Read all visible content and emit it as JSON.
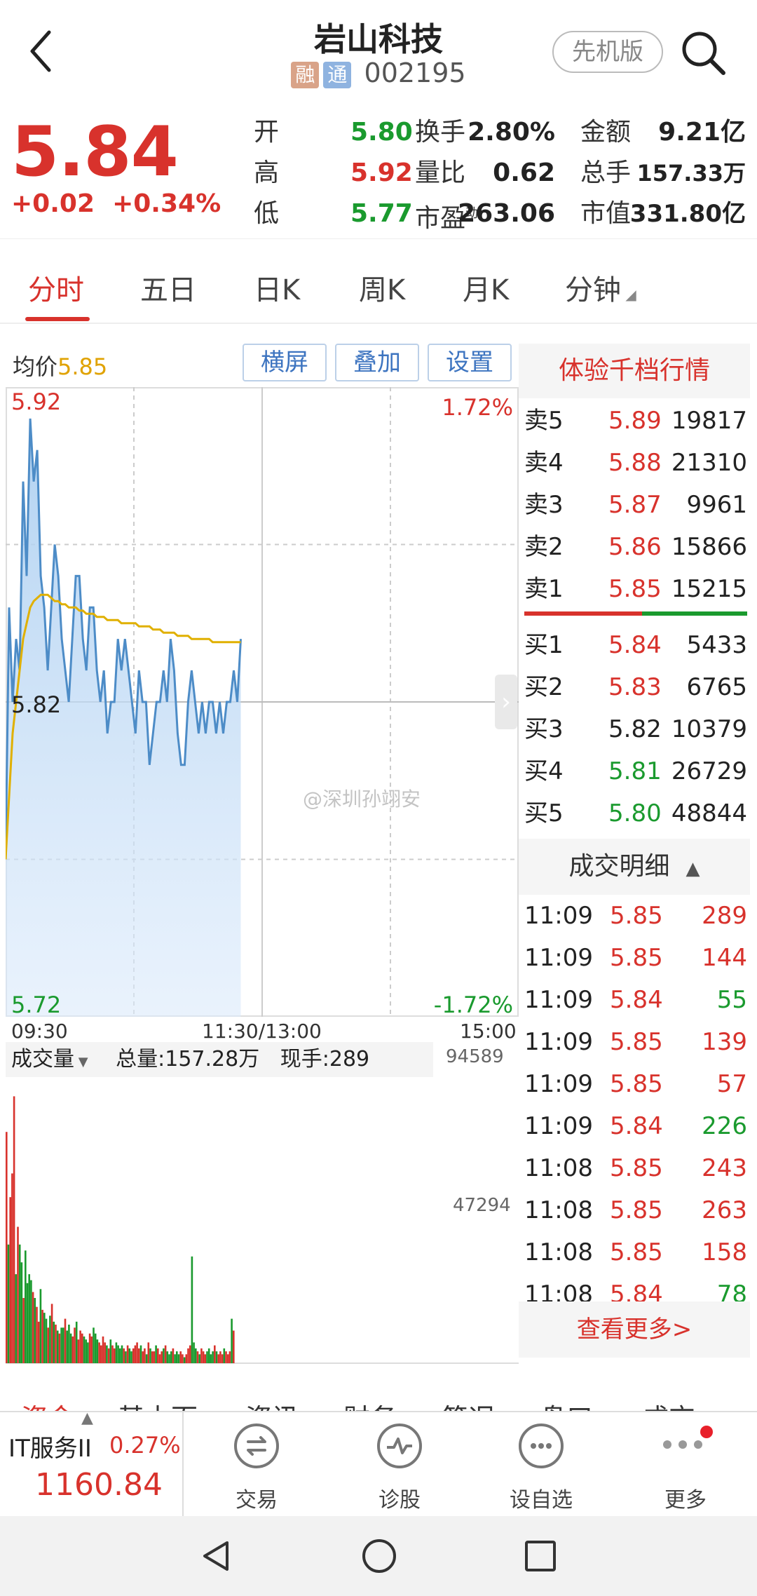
{
  "header": {
    "back_icon": "chevron-left-icon",
    "title": "岩山科技",
    "tag_rong": "融",
    "tag_tong": "通",
    "code": "002195",
    "pilot_label": "先机版",
    "search_icon": "search-icon"
  },
  "quote": {
    "price": "5.84",
    "change": "+0.02",
    "change_pct": "+0.34%",
    "rows": [
      {
        "l1": "开",
        "v1": "5.80",
        "c1": "green",
        "l2": "换手",
        "v2": "2.80%",
        "l3": "金额",
        "v3": "9.21亿"
      },
      {
        "l1": "高",
        "v1": "5.92",
        "c1": "red",
        "l2": "量比",
        "v2": "0.62",
        "l3": "总手",
        "v3": "157.33万"
      },
      {
        "l1": "低",
        "v1": "5.77",
        "c1": "green",
        "l2": "市盈",
        "l2_sup": "动",
        "v2": "263.06",
        "l3": "市值",
        "v3": "331.80亿"
      }
    ]
  },
  "tabs": [
    "分时",
    "五日",
    "日K",
    "周K",
    "月K",
    "分钟"
  ],
  "chart_controls": {
    "avg_label": "均价",
    "avg_value": "5.85",
    "buttons": [
      "横屏",
      "叠加",
      "设置"
    ]
  },
  "chart_data": {
    "type": "line",
    "title": "",
    "x_ticks": [
      "09:30",
      "11:30/13:00",
      "15:00"
    ],
    "y_left": {
      "max": "5.92",
      "mid": "5.82",
      "min": "5.72"
    },
    "y_right": {
      "max": "1.72%",
      "min": "-1.72%"
    },
    "ylim": [
      5.72,
      5.92
    ],
    "series": [
      {
        "values": [
          5.77,
          5.85,
          5.82,
          5.84,
          5.83,
          5.89,
          5.86,
          5.91,
          5.89,
          5.9,
          5.86,
          5.85,
          5.83,
          5.85,
          5.87,
          5.86,
          5.84,
          5.83,
          5.82,
          5.84,
          5.86,
          5.86,
          5.84,
          5.83,
          5.85,
          5.85,
          5.83,
          5.82,
          5.83,
          5.81,
          5.82,
          5.82,
          5.84,
          5.83,
          5.84,
          5.83,
          5.82,
          5.81,
          5.83,
          5.82,
          5.82,
          5.8,
          5.81,
          5.82,
          5.82,
          5.83,
          5.82,
          5.84,
          5.83,
          5.81,
          5.8,
          5.8,
          5.82,
          5.83,
          5.82,
          5.81,
          5.82,
          5.81,
          5.82,
          5.82,
          5.81,
          5.82,
          5.81,
          5.82,
          5.82,
          5.83,
          5.82,
          5.84
        ]
      },
      {
        "values": [
          5.77,
          5.79,
          5.81,
          5.82,
          5.83,
          5.84,
          5.845,
          5.85,
          5.852,
          5.853,
          5.854,
          5.854,
          5.854,
          5.853,
          5.852,
          5.852,
          5.851,
          5.851,
          5.85,
          5.85,
          5.85,
          5.849,
          5.849,
          5.848,
          5.848,
          5.848,
          5.847,
          5.847,
          5.847,
          5.846,
          5.846,
          5.846,
          5.846,
          5.845,
          5.845,
          5.845,
          5.845,
          5.845,
          5.844,
          5.844,
          5.844,
          5.844,
          5.843,
          5.843,
          5.843,
          5.842,
          5.842,
          5.842,
          5.842,
          5.841,
          5.841,
          5.841,
          5.841,
          5.84,
          5.84,
          5.84,
          5.84,
          5.84,
          5.84,
          5.839,
          5.839,
          5.839,
          5.839,
          5.839,
          5.839,
          5.839,
          5.839,
          5.839
        ]
      }
    ],
    "volume": {
      "label": "成交量",
      "total": "总量:157.28万",
      "current": "现手:289",
      "y_max": "94589",
      "y_mid": "47294",
      "ylim": [
        0,
        94589
      ],
      "bars": [
        78000,
        40000,
        56000,
        64000,
        90000,
        30000,
        46000,
        40000,
        34000,
        22000,
        38000,
        27000,
        30000,
        28000,
        24000,
        22000,
        19000,
        14000,
        25000,
        18000,
        17000,
        15000,
        12000,
        16000,
        20000,
        14000,
        13000,
        11000,
        10000,
        12000,
        12000,
        15000,
        11000,
        13000,
        10000,
        9000,
        12000,
        14000,
        8000,
        11000,
        10000,
        9000,
        8000,
        7000,
        10000,
        9000,
        12000,
        10000,
        8000,
        7000,
        6000,
        9000,
        7000,
        6000,
        5000,
        8000,
        6000,
        5000,
        7000,
        6000,
        5000,
        6000,
        5000,
        4000,
        6000,
        5000,
        4000,
        5000,
        6000,
        7000,
        5000,
        6000,
        4000,
        5000,
        3000,
        7000,
        5000,
        4000,
        4000,
        6000,
        5000,
        3000,
        4000,
        5000,
        6000,
        4000,
        3000,
        4000,
        5000,
        3000,
        4000,
        3000,
        4000,
        3000,
        2000,
        3000,
        5000,
        6000,
        36000,
        7000,
        5000,
        4000,
        3000,
        5000,
        4000,
        3000,
        4000,
        5000,
        3000,
        4000,
        6000,
        4000,
        3000,
        4000,
        3000,
        5000,
        4000,
        3000,
        4000,
        15000,
        11000
      ]
    }
  },
  "orderbook": {
    "header": "体验千档行情",
    "sells": [
      {
        "label": "卖5",
        "price": "5.89",
        "vol": "19817"
      },
      {
        "label": "卖4",
        "price": "5.88",
        "vol": "21310"
      },
      {
        "label": "卖3",
        "price": "5.87",
        "vol": "9961"
      },
      {
        "label": "卖2",
        "price": "5.86",
        "vol": "15866"
      },
      {
        "label": "卖1",
        "price": "5.85",
        "vol": "15215"
      }
    ],
    "buys": [
      {
        "label": "买1",
        "price": "5.84",
        "vol": "5433",
        "c": "red"
      },
      {
        "label": "买2",
        "price": "5.83",
        "vol": "6765",
        "c": "red"
      },
      {
        "label": "买3",
        "price": "5.82",
        "vol": "10379",
        "c": "black"
      },
      {
        "label": "买4",
        "price": "5.81",
        "vol": "26729",
        "c": "green"
      },
      {
        "label": "买5",
        "price": "5.80",
        "vol": "48844",
        "c": "green"
      }
    ]
  },
  "trades": {
    "header": "成交明细",
    "rows": [
      {
        "t": "11:09",
        "p": "5.85",
        "v": "289",
        "pc": "red",
        "vc": "red"
      },
      {
        "t": "11:09",
        "p": "5.85",
        "v": "144",
        "pc": "red",
        "vc": "red"
      },
      {
        "t": "11:09",
        "p": "5.84",
        "v": "55",
        "pc": "red",
        "vc": "green"
      },
      {
        "t": "11:09",
        "p": "5.85",
        "v": "139",
        "pc": "red",
        "vc": "red"
      },
      {
        "t": "11:09",
        "p": "5.85",
        "v": "57",
        "pc": "red",
        "vc": "red"
      },
      {
        "t": "11:09",
        "p": "5.84",
        "v": "226",
        "pc": "red",
        "vc": "green"
      },
      {
        "t": "11:08",
        "p": "5.85",
        "v": "243",
        "pc": "red",
        "vc": "red"
      },
      {
        "t": "11:08",
        "p": "5.85",
        "v": "263",
        "pc": "red",
        "vc": "red"
      },
      {
        "t": "11:08",
        "p": "5.85",
        "v": "158",
        "pc": "red",
        "vc": "red"
      },
      {
        "t": "11:08",
        "p": "5.84",
        "v": "78",
        "pc": "red",
        "vc": "green"
      }
    ],
    "more": "查看更多>"
  },
  "watermark": "@深圳孙翊安",
  "bottom_tabs": [
    "资金",
    "基本面",
    "资讯",
    "财务",
    "简况",
    "盘口",
    "成交"
  ],
  "sector": {
    "name": "IT服务II",
    "pct": "0.27%",
    "value": "1160.84"
  },
  "toolbar": [
    {
      "icon": "trade-icon",
      "label": "交易"
    },
    {
      "icon": "diagnose-icon",
      "label": "诊股"
    },
    {
      "icon": "watchlist-icon",
      "label": "设自选"
    },
    {
      "icon": "more-icon",
      "label": "更多"
    }
  ],
  "colors": {
    "red": "#d8322c",
    "green": "#1a9a2e",
    "line": "#4d8cc7",
    "avg": "#e0b000"
  }
}
